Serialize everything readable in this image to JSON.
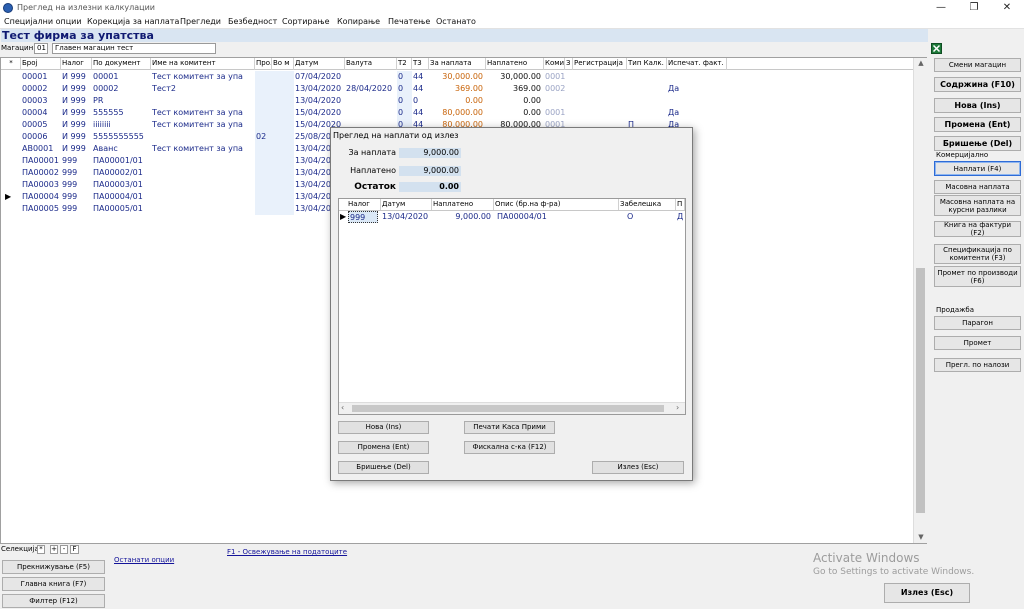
{
  "window": {
    "title": "Преглед на излезни калкулации",
    "controls": [
      "—",
      "❐",
      "✕"
    ]
  },
  "menu": [
    "Специјални опции",
    "Корекција за наплата",
    "Прегледи",
    "Безбедност",
    "Сортирање",
    "Копирање",
    "Печатење",
    "Останато"
  ],
  "company_title": "Тест фирма за упатства",
  "warehouse": {
    "label": "Магацин",
    "code": "01",
    "name": "Главен магацин тест"
  },
  "grid": {
    "headers": [
      "*",
      "Број",
      "Налог",
      "По документ",
      "Име на комитент",
      "Про.",
      "Во м",
      "Датум",
      "Валута",
      "Т2",
      "Т3",
      "За наплата",
      "Наплатено",
      "Коми",
      "З",
      "Регистрација",
      "Тип Калк.",
      "Испечат. факт."
    ],
    "rows": [
      {
        "broj": "00001",
        "nalog": "И 999",
        "dok": "00001",
        "komitent": "Тест комитент за упа",
        "pro": "",
        "vom": "",
        "datum": "07/04/2020",
        "valuta": "",
        "t2": "0",
        "t3": "44",
        "za": "30,000.00",
        "napl": "30,000.00",
        "komi": "0001",
        "tip": "",
        "isp": "",
        "za_color": "orange"
      },
      {
        "broj": "00002",
        "nalog": "И 999",
        "dok": "00002",
        "komitent": "Тест2",
        "pro": "",
        "vom": "",
        "datum": "13/04/2020",
        "valuta": "28/04/2020",
        "t2": "0",
        "t3": "44",
        "za": "369.00",
        "napl": "369.00",
        "komi": "0002",
        "tip": "",
        "isp": "Да",
        "za_color": "orange"
      },
      {
        "broj": "00003",
        "nalog": "И 999",
        "dok": "PR",
        "komitent": "",
        "pro": "",
        "vom": "",
        "datum": "13/04/2020",
        "valuta": "",
        "t2": "0",
        "t3": "0",
        "za": "0.00",
        "napl": "0.00",
        "komi": "",
        "tip": "",
        "isp": "",
        "za_color": "orange"
      },
      {
        "broj": "00004",
        "nalog": "И 999",
        "dok": "555555",
        "komitent": "Тест комитент за упа",
        "pro": "",
        "vom": "",
        "datum": "15/04/2020",
        "valuta": "",
        "t2": "0",
        "t3": "44",
        "za": "80,000.00",
        "napl": "0.00",
        "komi": "0001",
        "tip": "",
        "isp": "Да",
        "za_color": "orange"
      },
      {
        "broj": "00005",
        "nalog": "И 999",
        "dok": "iiiiiiii",
        "komitent": "Тест комитент за упа",
        "pro": "",
        "vom": "",
        "datum": "15/04/2020",
        "valuta": "",
        "t2": "0",
        "t3": "44",
        "za": "80,000.00",
        "napl": "80,000.00",
        "komi": "0001",
        "tip": "П",
        "isp": "Да",
        "za_color": "orange"
      },
      {
        "broj": "00006",
        "nalog": "И 999",
        "dok": "5555555555",
        "komitent": "",
        "pro": "02",
        "vom": "",
        "datum": "25/08/20",
        "valuta": "",
        "t2": "",
        "t3": "",
        "za": "",
        "napl": "",
        "komi": "",
        "tip": "",
        "isp": "",
        "za_color": "orange"
      },
      {
        "broj": "АВ0001",
        "nalog": "И 999",
        "dok": "Аванс",
        "komitent": "Тест комитент за упа",
        "pro": "",
        "vom": "",
        "datum": "13/04/20",
        "valuta": "",
        "t2": "",
        "t3": "",
        "za": "",
        "napl": "",
        "komi": "",
        "tip": "",
        "isp": "",
        "za_color": "orange"
      },
      {
        "broj": "ПА00001",
        "nalog": "999",
        "dok": "ПА00001/01",
        "komitent": "",
        "pro": "",
        "vom": "",
        "datum": "13/04/20",
        "valuta": "",
        "t2": "",
        "t3": "",
        "za": "",
        "napl": "",
        "komi": "",
        "tip": "",
        "isp": "",
        "za_color": "orange"
      },
      {
        "broj": "ПА00002",
        "nalog": "999",
        "dok": "ПА00002/01",
        "komitent": "",
        "pro": "",
        "vom": "",
        "datum": "13/04/20",
        "valuta": "",
        "t2": "",
        "t3": "",
        "za": "",
        "napl": "",
        "komi": "",
        "tip": "",
        "isp": "",
        "za_color": "orange"
      },
      {
        "broj": "ПА00003",
        "nalog": "999",
        "dok": "ПА00003/01",
        "komitent": "",
        "pro": "",
        "vom": "",
        "datum": "13/04/20",
        "valuta": "",
        "t2": "",
        "t3": "",
        "za": "",
        "napl": "",
        "komi": "",
        "tip": "",
        "isp": "",
        "za_color": "orange"
      },
      {
        "broj": "ПА00004",
        "nalog": "999",
        "dok": "ПА00004/01",
        "komitent": "",
        "pro": "",
        "vom": "",
        "datum": "13/04/20",
        "valuta": "",
        "t2": "",
        "t3": "",
        "za": "",
        "napl": "",
        "komi": "",
        "tip": "",
        "isp": "",
        "za_color": "orange"
      },
      {
        "broj": "ПА00005",
        "nalog": "999",
        "dok": "ПА00005/01",
        "komitent": "",
        "pro": "",
        "vom": "",
        "datum": "13/04/20",
        "valuta": "",
        "t2": "",
        "t3": "",
        "za": "",
        "napl": "",
        "komi": "",
        "tip": "",
        "isp": "",
        "za_color": "orange"
      }
    ],
    "current_row_index": 10
  },
  "right_panel": {
    "change_warehouse": "Смени магацин",
    "content": "Содржина (F10)",
    "new": "Нова (Ins)",
    "edit": "Промена (Ent)",
    "delete": "Бришење (Del)",
    "commercial_label": "Комерцијално",
    "payments": "Наплати (F4)",
    "mass_payment": "Масовна наплата",
    "mass_payment_fx": "Масовна наплата на курсни разлики",
    "invoice_book": "Книга на фактури (F2)",
    "spec_clients": "Спецификација по комитенти (F3)",
    "turnover_products": "Промет по производи (F6)",
    "sales_label": "Продажба",
    "paragon": "Парагон",
    "turnover": "Промет",
    "review_orders": "Прегл. по налози"
  },
  "bottom": {
    "selection_label": "Селекција",
    "sel_buttons": [
      "*",
      "+",
      "-",
      "F"
    ],
    "other_options": "Останати опции",
    "refresh_link": "F1 - Освежување на податоците",
    "renumber": "Прекнижување (F5)",
    "ledger": "Главна книга (F7)",
    "filter": "Филтер (F12)",
    "exit": "Излез (Esc)"
  },
  "activate": {
    "line1": "Activate Windows",
    "line2": "Go to Settings to activate Windows."
  },
  "dialog": {
    "title": "Преглед на наплати од излез",
    "to_pay_label": "За наплата",
    "to_pay_value": "9,000.00",
    "paid_label": "Наплатено",
    "paid_value": "9,000.00",
    "balance_label": "Остаток",
    "balance_value": "0.00",
    "headers": [
      "Налог",
      "Датум",
      "Наплатено",
      "Опис (бр.на ф-ра)",
      "Забелешка",
      "П"
    ],
    "row": {
      "nalog": "999",
      "datum": "13/04/2020",
      "napl": "9,000.00",
      "opis": "ПА00004/01",
      "zab": "О",
      "p": "Д"
    },
    "btn_new": "Нова (Ins)",
    "btn_edit": "Промена (Ent)",
    "btn_delete": "Бришење (Del)",
    "btn_print": "Печати Каса Прими",
    "btn_fiscal": "Фискална с-ка (F12)",
    "btn_exit": "Излез (Esc)"
  }
}
